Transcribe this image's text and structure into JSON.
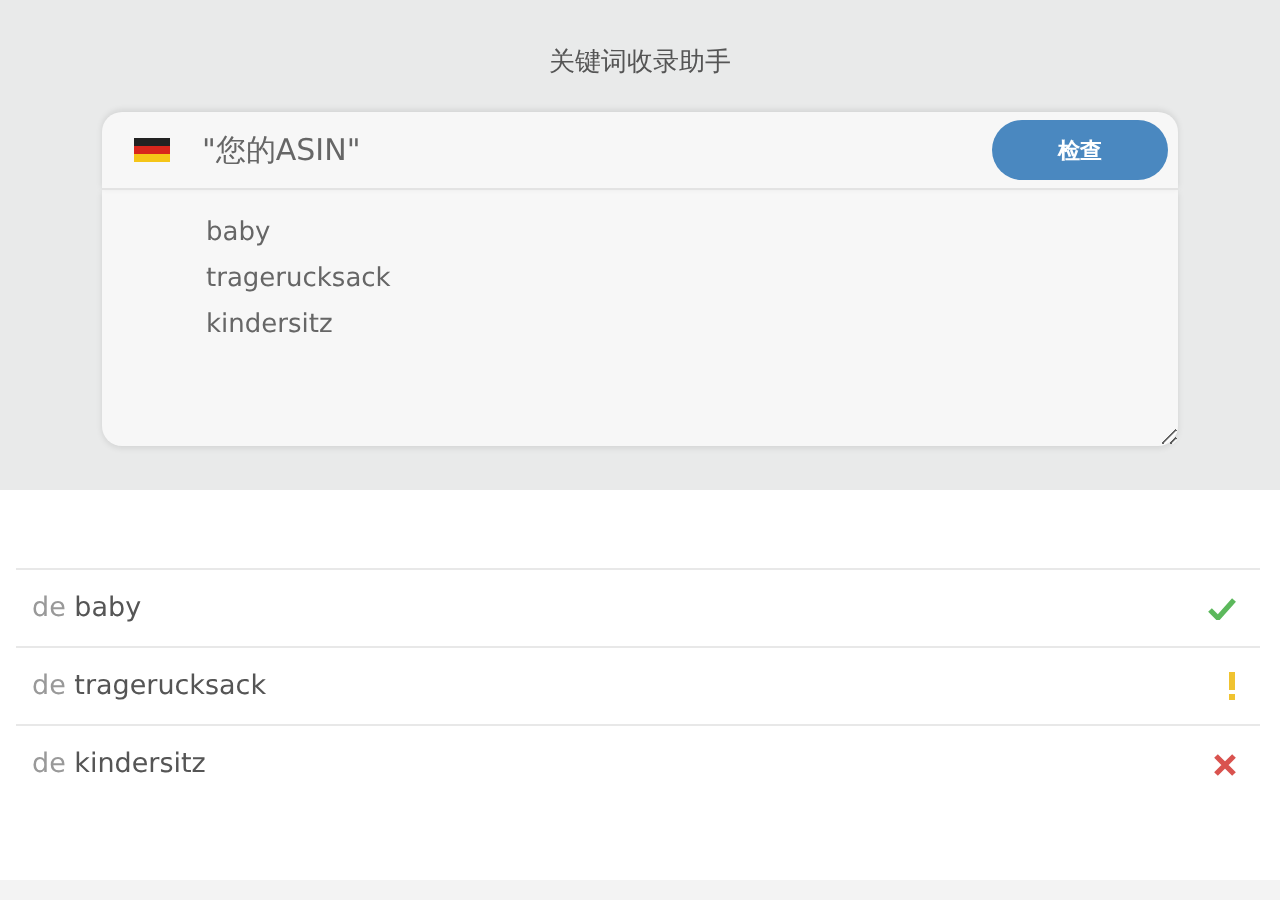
{
  "title": "关键词收录助手",
  "asin_field": {
    "placeholder": "\"您的ASIN\""
  },
  "check_button": "检查",
  "keywords_field": {
    "value": "baby\ntragerucksack\nkindersitz"
  },
  "results": [
    {
      "market": "de",
      "keyword": "baby",
      "kind": "indexed"
    },
    {
      "market": "de",
      "keyword": "tragerucksack",
      "kind": "warning"
    },
    {
      "market": "de",
      "keyword": "kindersitz",
      "kind": "not_indexed"
    }
  ]
}
